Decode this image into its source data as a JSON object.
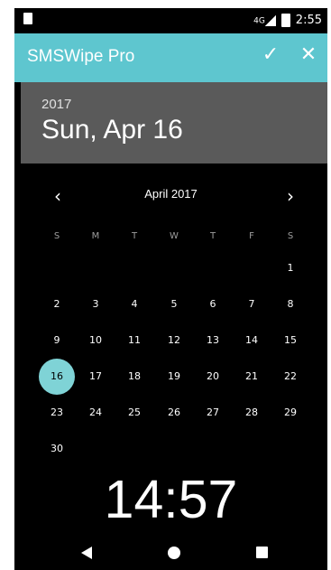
{
  "status_bar": {
    "network": "4G",
    "time": "2:55"
  },
  "app_bar": {
    "title": "SMSWipe Pro",
    "confirm_icon": "check-icon",
    "cancel_icon": "close-icon"
  },
  "date_header": {
    "year": "2017",
    "selected_date": "Sun, Apr 16"
  },
  "calendar": {
    "month_label": "April 2017",
    "weekdays": [
      "S",
      "M",
      "T",
      "W",
      "T",
      "F",
      "S"
    ],
    "days": [
      "1",
      "2",
      "3",
      "4",
      "5",
      "6",
      "7",
      "8",
      "9",
      "10",
      "11",
      "12",
      "13",
      "14",
      "15",
      "16",
      "17",
      "18",
      "19",
      "20",
      "21",
      "22",
      "23",
      "24",
      "25",
      "26",
      "27",
      "28",
      "29",
      "30"
    ],
    "selected_day": "16",
    "accent_color": "#7fd3d6"
  },
  "time_display": "14:57",
  "colors": {
    "app_bar": "#5ec6cf",
    "header_bg": "#5a5a5a",
    "background": "#000000"
  }
}
